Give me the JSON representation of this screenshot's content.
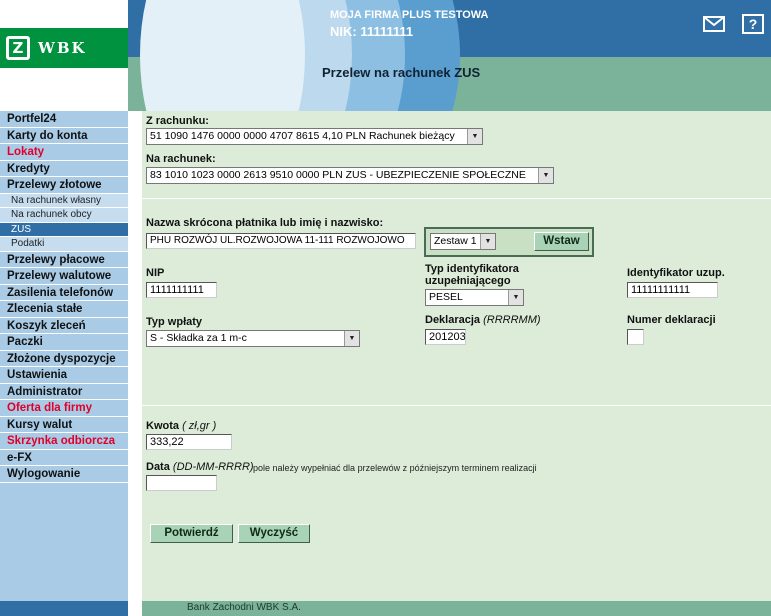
{
  "header": {
    "logo_text": "WBK",
    "company": "MOJA FIRMA PLUS TESTOWA",
    "nik": "NIK: 11111111",
    "page_title": "Przelew na rachunek ZUS",
    "help_label": "?",
    "icons": [
      "mail-icon",
      "help-icon"
    ]
  },
  "sidebar": {
    "items": [
      {
        "label": "Portfel24",
        "type": "item"
      },
      {
        "label": "Karty do konta",
        "type": "item"
      },
      {
        "label": "Lokaty",
        "type": "item",
        "color": "#e0002a"
      },
      {
        "label": "Kredyty",
        "type": "item"
      },
      {
        "label": "Przelewy złotowe",
        "type": "item"
      },
      {
        "label": "Na rachunek własny",
        "type": "sub"
      },
      {
        "label": "Na rachunek obcy",
        "type": "sub"
      },
      {
        "label": "ZUS",
        "type": "sub",
        "active": true
      },
      {
        "label": "Podatki",
        "type": "sub"
      },
      {
        "label": "Przelewy płacowe",
        "type": "item"
      },
      {
        "label": "Przelewy walutowe",
        "type": "item"
      },
      {
        "label": "Zasilenia telefonów",
        "type": "item"
      },
      {
        "label": "Zlecenia stałe",
        "type": "item"
      },
      {
        "label": "Koszyk zleceń",
        "type": "item"
      },
      {
        "label": "Paczki",
        "type": "item"
      },
      {
        "label": "Złożone dyspozycje",
        "type": "item"
      },
      {
        "label": "Ustawienia",
        "type": "item"
      },
      {
        "label": "Administrator",
        "type": "item"
      },
      {
        "label": "Oferta dla firmy",
        "type": "item",
        "color": "#e0002a"
      },
      {
        "label": "Kursy walut",
        "type": "item"
      },
      {
        "label": "Skrzynka odbiorcza",
        "type": "item",
        "color": "#e0002a"
      },
      {
        "label": "e-FX",
        "type": "item"
      },
      {
        "label": "Wylogowanie",
        "type": "item"
      }
    ]
  },
  "form": {
    "from_label": "Z rachunku:",
    "from_value": "51 1090 1476 0000 0000 4707 8615  4,10 PLN Rachunek bieżący",
    "to_label": "Na rachunek:",
    "to_value": "83 1010 1023 0000 2613 9510 0000  PLN     ZUS - UBEZPIECZENIE SPOŁECZNE",
    "payer_label": "Nazwa skrócona płatnika lub imię i nazwisko:",
    "payer_value": "PHU ROZWÓJ UL.ROZWOJOWA 11-111 ROZWOJOWO",
    "zestaw_value": "Zestaw 1",
    "insert_button": "Wstaw",
    "nip_label": "NIP",
    "nip_value": "1111111111",
    "id_type_label_1": "Typ identyfikatora",
    "id_type_label_2": "uzupełniającego",
    "id_type_value": "PESEL",
    "id_extra_label": "Identyfikator uzup.",
    "id_extra_value": "11111111111",
    "payment_type_label": "Typ wpłaty",
    "payment_type_value": "S - Składka za 1 m-c",
    "declaration_label": "Deklaracja",
    "declaration_format": "(RRRRMM)",
    "declaration_value": "201203",
    "declaration_number_label": "Numer deklaracji",
    "declaration_number_value": "",
    "amount_label": "Kwota",
    "amount_format": "( zł,gr )",
    "amount_value": "333,22",
    "date_label": "Data",
    "date_format": "(DD-MM-RRRR)",
    "date_note": "pole należy wypełniać dla przelewów z późniejszym terminem realizacji",
    "date_value": "",
    "confirm_button": "Potwierdź",
    "clear_button": "Wyczyść"
  },
  "footer": {
    "text": "Bank Zachodni WBK S.A."
  },
  "colors": {
    "brand_green": "#00923f",
    "header_blue": "#2f6fa6",
    "accent_red": "#e0002a",
    "content_bg": "#dcecd8"
  }
}
